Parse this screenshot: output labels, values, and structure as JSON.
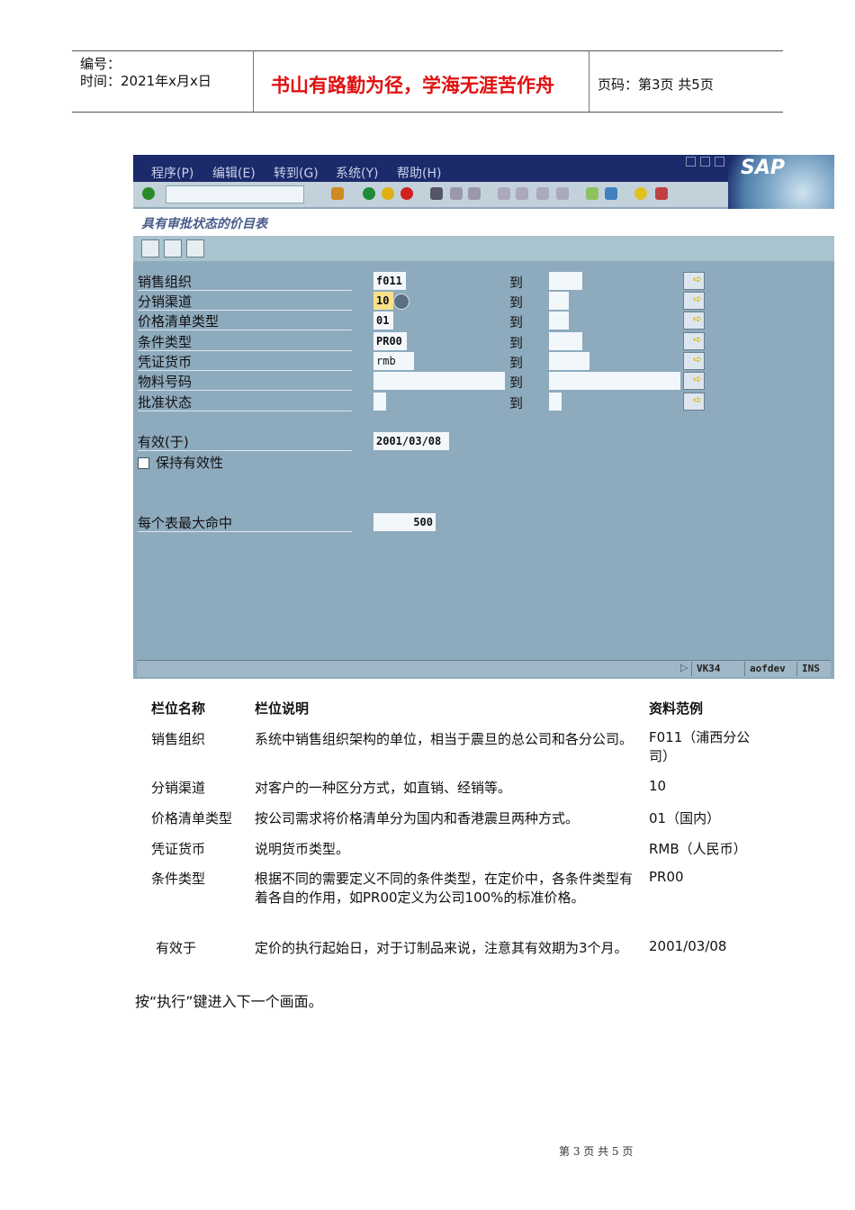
{
  "header": {
    "number_label": "编号：",
    "time_label": "时间：2021年x月x日",
    "motto": "书山有路勤为径，学海无涯苦作舟",
    "page_info": "页码：第3页 共5页"
  },
  "sap": {
    "menus": [
      "程序(P)",
      "编辑(E)",
      "转到(G)",
      "系统(Y)",
      "帮助(H)"
    ],
    "logo": "SAP",
    "screen_title": "具有审批状态的价目表",
    "to_label": "到",
    "fields": [
      {
        "label": "销售组织",
        "value": "f011"
      },
      {
        "label": "分销渠道",
        "value": "10"
      },
      {
        "label": "价格清单类型",
        "value": "01"
      },
      {
        "label": "条件类型",
        "value": "PR00"
      },
      {
        "label": "凭证货币",
        "value": "rmb"
      },
      {
        "label": "物料号码",
        "value": ""
      },
      {
        "label": "批准状态",
        "value": ""
      }
    ],
    "valid_from_label": "有效(于)",
    "valid_from_value": "2001/03/08",
    "keep_valid_label": "保持有效性",
    "max_hits_label": "每个表最大命中",
    "max_hits_value": "500",
    "status": {
      "tcode": "VK34",
      "server": "aofdev",
      "mode": "INS"
    }
  },
  "table": {
    "headers": [
      "栏位名称",
      "栏位说明",
      "资料范例"
    ],
    "rows": [
      [
        "销售组织",
        "系统中销售组织架构的单位，相当于震旦的总公司和各分公司。",
        "F011（浦西分公司）"
      ],
      [
        "分销渠道",
        "对客户的一种区分方式，如直销、经销等。",
        "10"
      ],
      [
        "价格清单类型",
        "按公司需求将价格清单分为国内和香港震旦两种方式。",
        "01（国内）"
      ],
      [
        "凭证货币",
        "说明货币类型。",
        "RMB（人民币）"
      ],
      [
        "条件类型",
        "根据不同的需要定义不同的条件类型，在定价中，各条件类型有着各自的作用，如PR00定义为公司100%的标准价格。",
        "PR00"
      ],
      [
        "有效于",
        "定价的执行起始日，对于订制品来说，注意其有效期为3个月。",
        "2001/03/08"
      ]
    ]
  },
  "instruction": "按“执行”键进入下一个画面。",
  "footer": "第 3 页 共 5 页"
}
